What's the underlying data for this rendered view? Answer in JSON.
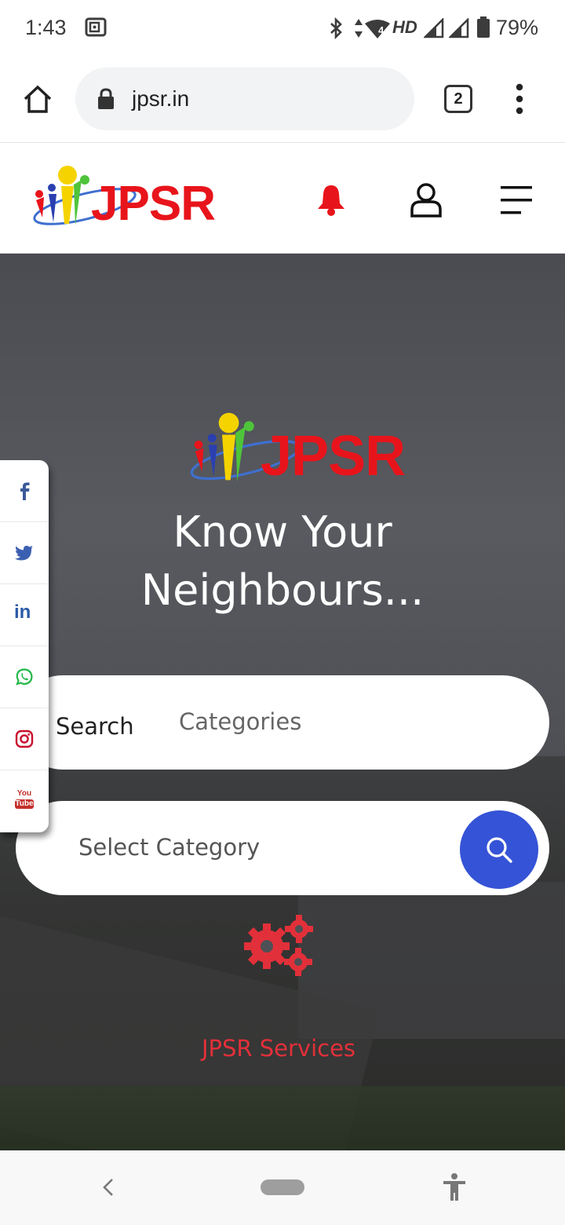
{
  "status_bar": {
    "time": "1:43",
    "network_label": "HD",
    "network_small": "4",
    "battery": "79%"
  },
  "browser": {
    "url": "jpsr.in",
    "tab_count": "2"
  },
  "site": {
    "logo_text": "JPSR",
    "brand_color": "#e8141b"
  },
  "hero": {
    "logo_text": "JPSR",
    "title_line1": "Know Your",
    "title_line2": "Neighbours...",
    "search_tab": "Search",
    "categories_tab": "Categories",
    "select_placeholder": "Select Category",
    "services_label": "JPSR Services",
    "button_color": "#3553d6",
    "accent_color": "#e2303a"
  },
  "social": {
    "items": [
      "facebook-icon",
      "twitter-icon",
      "linkedin-icon",
      "whatsapp-icon",
      "instagram-icon",
      "youtube-icon"
    ],
    "linkedin_text": "in",
    "youtube_text_top": "You",
    "youtube_text_bottom": "Tube"
  }
}
